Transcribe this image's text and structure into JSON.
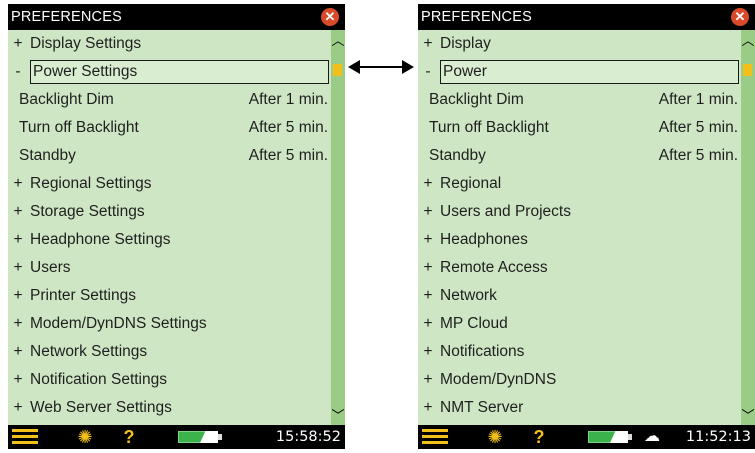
{
  "left": {
    "title": "PREFERENCES",
    "rows": [
      {
        "sign": "+",
        "label": "Display Settings",
        "value": ""
      },
      {
        "sign": "-",
        "label": "Power Settings",
        "value": "",
        "selected": true
      },
      {
        "sign": "",
        "label": "Backlight Dim",
        "value": "After 1 min.",
        "indent": true
      },
      {
        "sign": "",
        "label": "Turn off Backlight",
        "value": "After 5 min.",
        "indent": true
      },
      {
        "sign": "",
        "label": "Standby",
        "value": "After 5 min.",
        "indent": true
      },
      {
        "sign": "+",
        "label": "Regional Settings",
        "value": ""
      },
      {
        "sign": "+",
        "label": "Storage Settings",
        "value": ""
      },
      {
        "sign": "+",
        "label": "Headphone Settings",
        "value": ""
      },
      {
        "sign": "+",
        "label": "Users",
        "value": ""
      },
      {
        "sign": "+",
        "label": "Printer Settings",
        "value": ""
      },
      {
        "sign": "+",
        "label": "Modem/DynDNS Settings",
        "value": ""
      },
      {
        "sign": "+",
        "label": "Network Settings",
        "value": ""
      },
      {
        "sign": "+",
        "label": "Notification Settings",
        "value": ""
      },
      {
        "sign": "+",
        "label": "Web Server Settings",
        "value": ""
      }
    ],
    "clock": "15:58:52",
    "status_icons": [
      "menu-icon",
      "backlight-icon",
      "help-icon",
      "battery-charging-icon"
    ]
  },
  "right": {
    "title": "PREFERENCES",
    "rows": [
      {
        "sign": "+",
        "label": "Display",
        "value": ""
      },
      {
        "sign": "-",
        "label": "Power",
        "value": "",
        "selected": true
      },
      {
        "sign": "",
        "label": "Backlight Dim",
        "value": "After 1 min.",
        "indent": true
      },
      {
        "sign": "",
        "label": "Turn off Backlight",
        "value": "After 5 min.",
        "indent": true
      },
      {
        "sign": "",
        "label": "Standby",
        "value": "After 5 min.",
        "indent": true
      },
      {
        "sign": "+",
        "label": "Regional",
        "value": ""
      },
      {
        "sign": "+",
        "label": "Users and Projects",
        "value": ""
      },
      {
        "sign": "+",
        "label": "Headphones",
        "value": ""
      },
      {
        "sign": "+",
        "label": "Remote Access",
        "value": ""
      },
      {
        "sign": "+",
        "label": "Network",
        "value": ""
      },
      {
        "sign": "+",
        "label": "MP Cloud",
        "value": ""
      },
      {
        "sign": "+",
        "label": "Notifications",
        "value": ""
      },
      {
        "sign": "+",
        "label": "Modem/DynDNS",
        "value": ""
      },
      {
        "sign": "+",
        "label": "NMT Server",
        "value": ""
      }
    ],
    "clock": "11:52:13",
    "status_icons": [
      "menu-icon",
      "backlight-icon",
      "help-icon",
      "battery-charging-icon",
      "cloud-icon"
    ]
  },
  "colors": {
    "content_bg": "#cfe6c4",
    "scrollbar": "#9bcc86",
    "accent": "#f2c01a",
    "close": "#d84a2a",
    "battery": "#3bb24a"
  }
}
